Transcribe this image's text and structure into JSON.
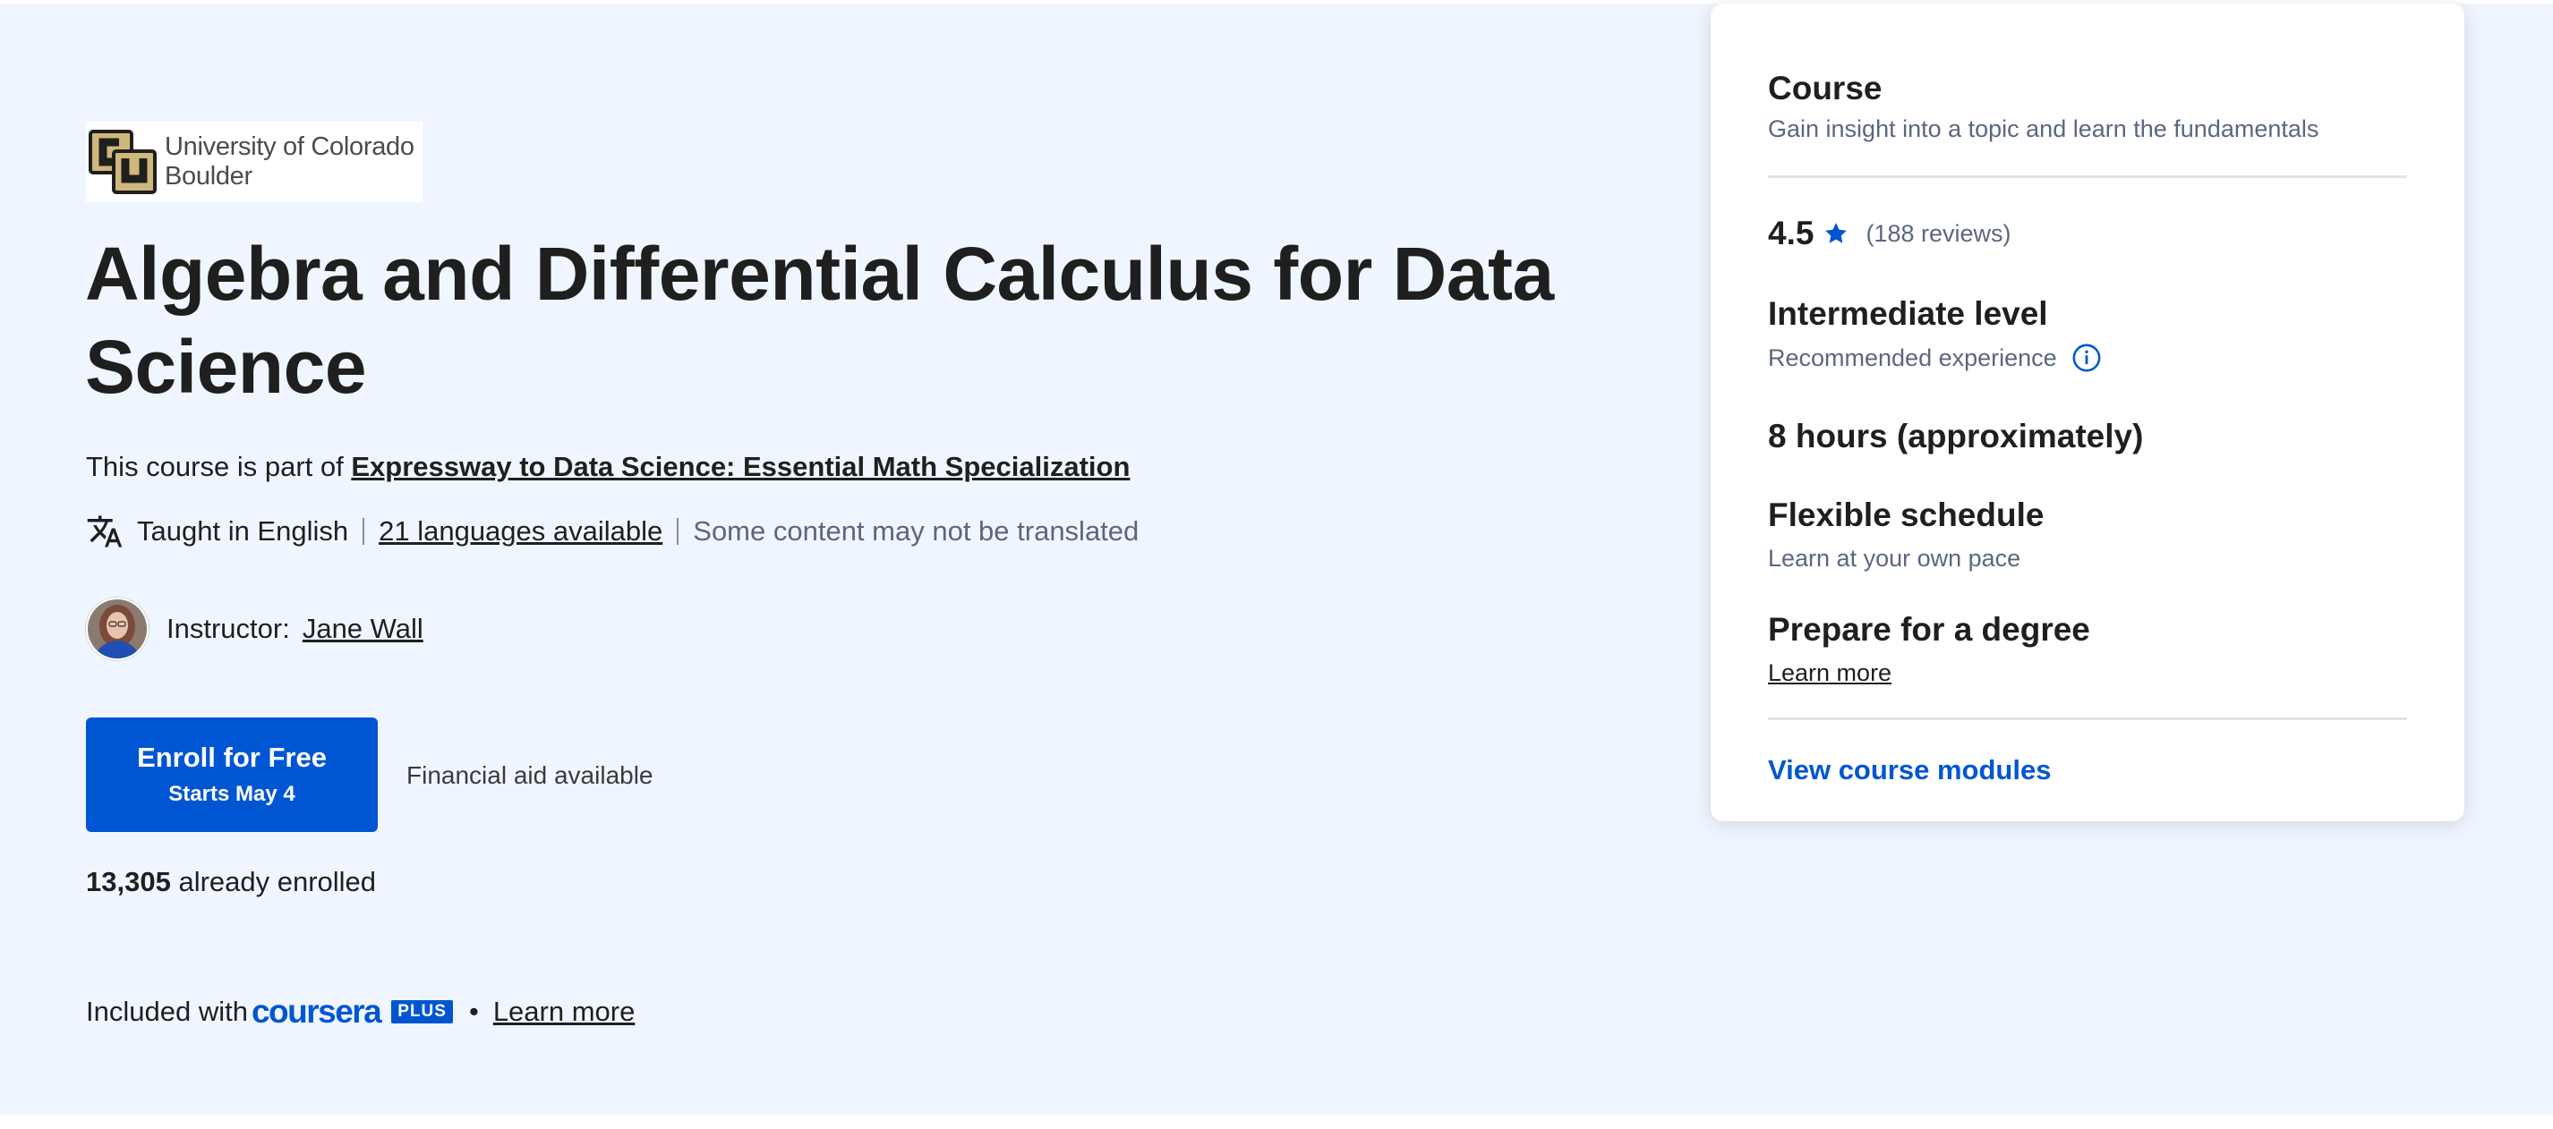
{
  "university": {
    "logo_name": "cu-buffalo-logo",
    "line1": "University of Colorado",
    "line2": "Boulder"
  },
  "course": {
    "title": "Algebra and Differential Calculus for Data Science",
    "part_of_prefix": "This course is part of",
    "specialization_link": "Expressway to Data Science: Essential Math Specialization"
  },
  "language": {
    "icon": "translate-icon",
    "taught_in": "Taught in English",
    "languages_link": "21 languages available",
    "note": "Some content may not be translated"
  },
  "instructor": {
    "label": "Instructor:",
    "name": "Jane Wall"
  },
  "enroll": {
    "label": "Enroll for Free",
    "starts": "Starts May 4",
    "financial_aid": "Financial aid available",
    "enrolled_count": "13,305",
    "enrolled_suffix": "already enrolled"
  },
  "included": {
    "prefix": "Included with",
    "brand": "coursera",
    "badge": "PLUS",
    "separator": "•",
    "learn_more": "Learn more"
  },
  "card": {
    "heading": "Course",
    "subheading": "Gain insight into a topic and learn the fundamentals",
    "rating": "4.5",
    "reviews": "(188 reviews)",
    "level_title": "Intermediate level",
    "level_sub": "Recommended experience",
    "duration": "8 hours (approximately)",
    "schedule_title": "Flexible schedule",
    "schedule_sub": "Learn at your own pace",
    "degree_title": "Prepare for a degree",
    "degree_link": "Learn more",
    "view_modules": "View course modules"
  },
  "colors": {
    "brand_blue": "#0056d2",
    "hero_background": "#f0f6ff",
    "cu_gold": "#cfb87c"
  }
}
